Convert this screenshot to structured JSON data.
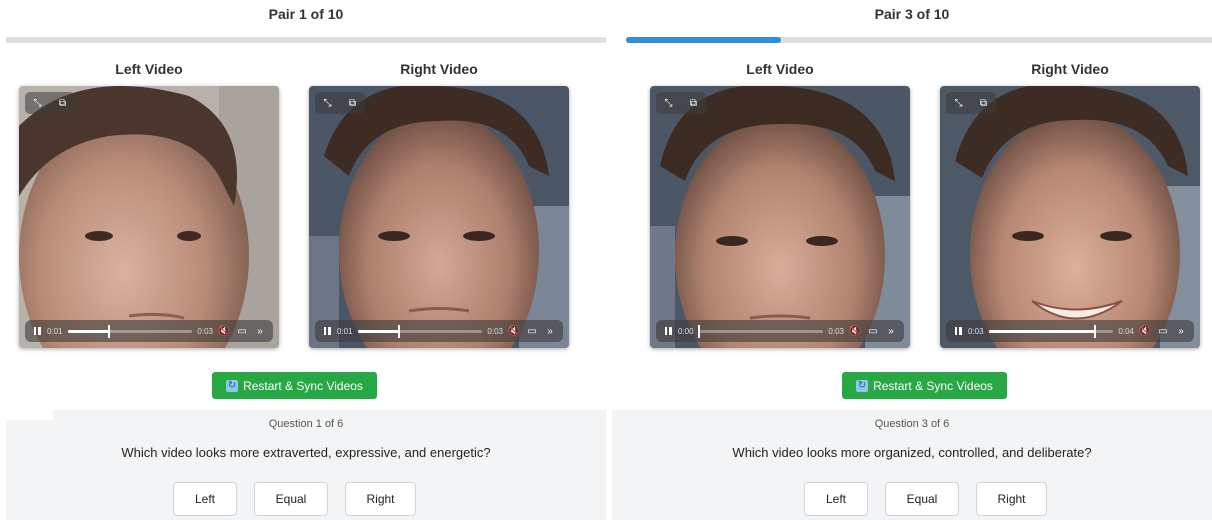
{
  "panels": [
    {
      "title": "Pair 1 of 10",
      "progress": 0,
      "left_label": "Left Video",
      "right_label": "Right Video",
      "left_video": {
        "current": "0:01",
        "duration": "0:03",
        "played": 0.33
      },
      "right_video": {
        "current": "0:01",
        "duration": "0:03",
        "played": 0.33
      },
      "sync_label": "Restart & Sync Videos",
      "question_count": "Question 1 of 6",
      "question": "Which video looks more extraverted, expressive, and energetic?",
      "choices": [
        "Left",
        "Equal",
        "Right"
      ]
    },
    {
      "title": "Pair 3 of 10",
      "progress": 0.26,
      "left_label": "Left Video",
      "right_label": "Right Video",
      "left_video": {
        "current": "0:00",
        "duration": "0:03",
        "played": 0.0
      },
      "right_video": {
        "current": "0:03",
        "duration": "0:04",
        "played": 0.85
      },
      "sync_label": "Restart & Sync Videos",
      "question_count": "Question 3 of 6",
      "question": "Which video looks more organized, controlled, and deliberate?",
      "choices": [
        "Left",
        "Equal",
        "Right"
      ]
    }
  ],
  "icons": {
    "fullscreen": "fullscreen-icon",
    "pip": "picture-in-picture-icon",
    "pause": "pause-icon",
    "mute": "muted-speaker-icon",
    "airplay": "airplay-icon",
    "more": "double-chevron-icon",
    "sync": "sync-icon"
  },
  "colors": {
    "progress": "#2e8fd8",
    "sync_button": "#28a745",
    "question_bg": "#f2f4f6"
  }
}
